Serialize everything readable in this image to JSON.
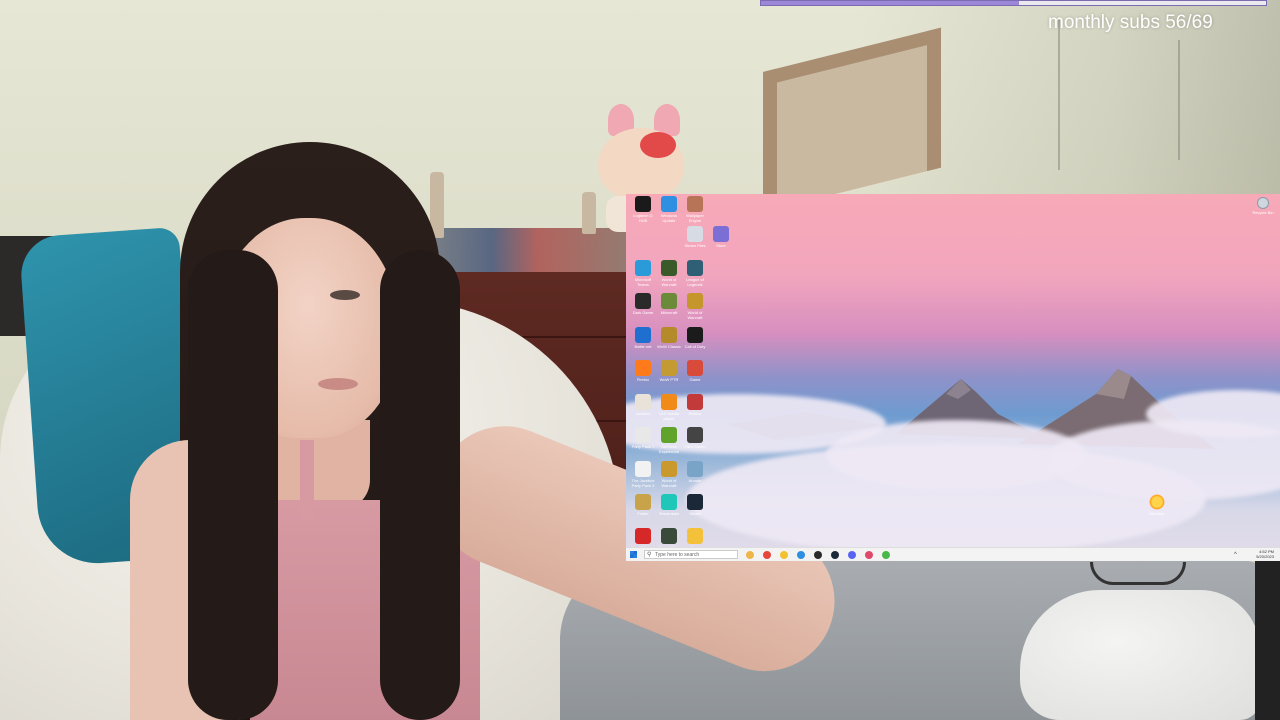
{
  "overlay": {
    "sub_goal_text": "monthly subs 56/69",
    "sub_goal_progress": 0.51,
    "sub_bar_color": "#9c86d8"
  },
  "desktop": {
    "wallpaper": "pink sunset over mountains above clouds",
    "icons": [
      {
        "name": "ghub-icon",
        "label": "Logitech G HUB",
        "color": "#1a1a1a"
      },
      {
        "name": "windows-update-icon",
        "label": "Windows Update",
        "color": "#2f8fe0"
      },
      {
        "name": "wallpaper-engine-icon",
        "label": "Wallpaper Engine",
        "color": "#b77457"
      },
      {
        "name": "blank-icon",
        "label": "",
        "color": "transparent"
      },
      {
        "name": "files-icon",
        "label": "Steam Files",
        "color": "#d7dbe3"
      },
      {
        "name": "ms-store-icon",
        "label": "Store",
        "color": "#7b6fd6"
      },
      {
        "name": "ms-teams-icon",
        "label": "Microsoft Teams",
        "color": "#2b9ad8"
      },
      {
        "name": "warcraft-map-icon",
        "label": "World of Warcraft",
        "color": "#3b5a2a"
      },
      {
        "name": "league-icon",
        "label": "League of Legends",
        "color": "#2e5f74"
      },
      {
        "name": "game-dark-icon",
        "label": "Dark Game",
        "color": "#2a2a2a"
      },
      {
        "name": "minecraft-icon",
        "label": "Minecraft",
        "color": "#6b8a3a"
      },
      {
        "name": "wow-icon",
        "label": "World of Warcraft",
        "color": "#c4962c"
      },
      {
        "name": "battlenet-icon",
        "label": "Battle.net",
        "color": "#1f6fd1"
      },
      {
        "name": "wow-classic-icon",
        "label": "WoW Classic",
        "color": "#b58a2a"
      },
      {
        "name": "cod-icon",
        "label": "Call of Duty",
        "color": "#1b1b1b"
      },
      {
        "name": "firefox-icon",
        "label": "Firefox",
        "color": "#ff7a1a"
      },
      {
        "name": "wow-2-icon",
        "label": "WoW PTR",
        "color": "#c49a32"
      },
      {
        "name": "logo-game-icon",
        "label": "Game",
        "color": "#d84a3a"
      },
      {
        "name": "jackbox-icon",
        "label": "Jackbox",
        "color": "#e8e2d8"
      },
      {
        "name": "vlc-icon",
        "label": "VLC media player",
        "color": "#f08a18"
      },
      {
        "name": "roblox-icon",
        "label": "Roblox",
        "color": "#c23a3a"
      },
      {
        "name": "party-pack-icon",
        "label": "Party Pack 1",
        "color": "#e8e8e8"
      },
      {
        "name": "nvidia-icon",
        "label": "GeForce Experience",
        "color": "#5fa32b"
      },
      {
        "name": "obs-icon",
        "label": "OBS Studio",
        "color": "#444444"
      },
      {
        "name": "party-pack-2-icon",
        "label": "The Jackbox Party Pack 3",
        "color": "#f2f2f2"
      },
      {
        "name": "wow-3-icon",
        "label": "World of Warcraft",
        "color": "#c9992e"
      },
      {
        "name": "arcade-icon",
        "label": "Arcade",
        "color": "#7aa3c8"
      },
      {
        "name": "folder-icon",
        "label": "Folder",
        "color": "#c9a34a"
      },
      {
        "name": "twitch-tool-icon",
        "label": "Streamlabs",
        "color": "#1ec7b7"
      },
      {
        "name": "steam-icon",
        "label": "Steam",
        "color": "#1b2838"
      },
      {
        "name": "game-912-icon",
        "label": "912",
        "color": "#d62828"
      },
      {
        "name": "terminal-icon",
        "label": "Game Files",
        "color": "#3a4a3a"
      },
      {
        "name": "emoji-game-icon",
        "label": "Game",
        "color": "#f3c23a"
      },
      {
        "name": "scroll-icon",
        "label": "Scroll",
        "color": "#b3241f"
      }
    ],
    "right_icon_label": "Recycle Bin",
    "sun_icon_label": "Weather",
    "taskbar": {
      "search_placeholder": "Type here to search",
      "clock_time": "4:52 PM",
      "clock_date": "5/20/2023",
      "apps": [
        "copilot-icon",
        "chrome-icon",
        "file-explorer-icon",
        "edge-icon",
        "obs-taskbar-icon",
        "steam-taskbar-icon",
        "discord-icon",
        "music-icon",
        "green-app-icon"
      ]
    }
  }
}
